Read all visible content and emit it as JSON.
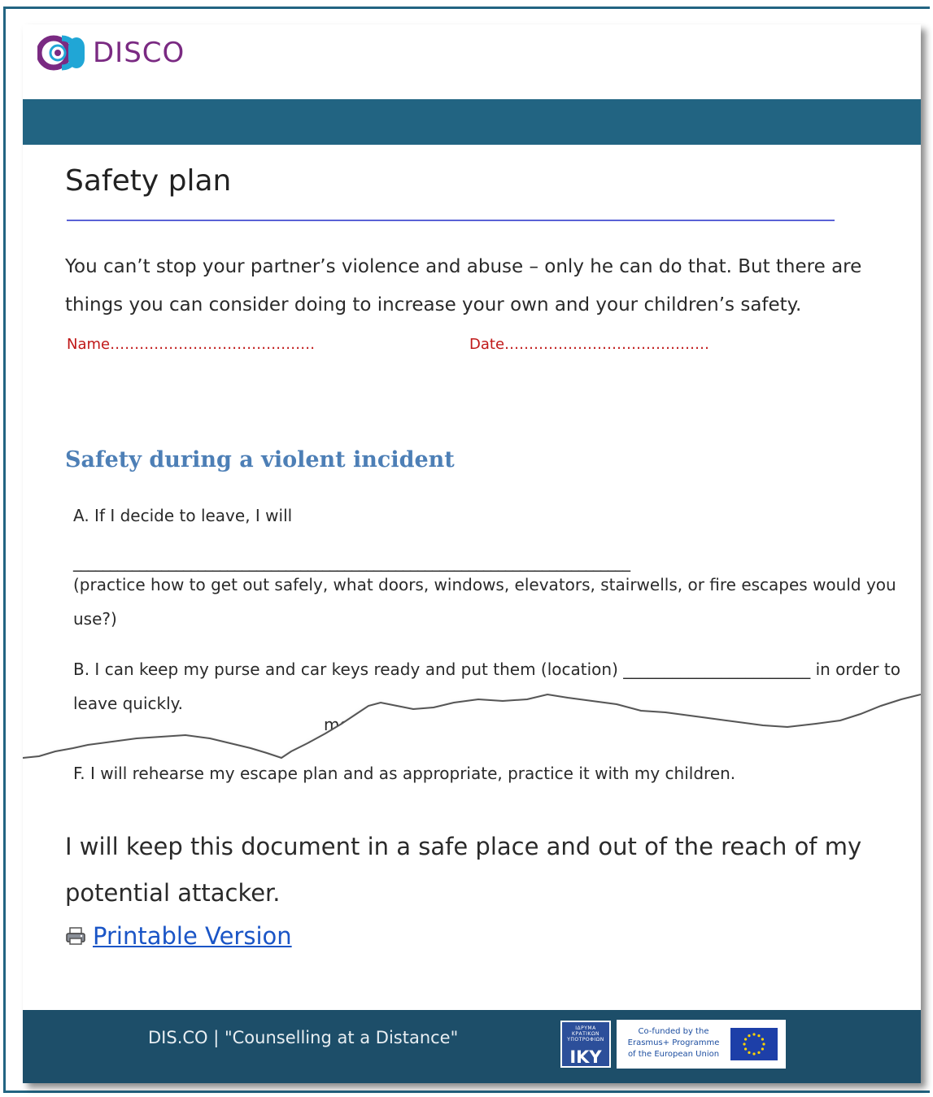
{
  "brand": {
    "logo_text": "DISCO",
    "logo_colors": [
      "#7a2a82",
      "#20a6d6"
    ]
  },
  "page": {
    "title": "Safety plan"
  },
  "intro": {
    "text": "You can’t stop your partner’s violence and abuse – only he can do that. But there are things you can consider doing to increase your own and your children’s safety."
  },
  "fields": {
    "name_label": "Name……………………………………",
    "date_label": "Date……………………………………"
  },
  "section": {
    "heading": "Safety during a violent incident",
    "items": {
      "a_prompt": "A. If I decide to leave, I will",
      "a_blank": "____________________________________________________________________________",
      "a_note": "(practice how to get out safely, what doors, windows, elevators, stairwells, or fire escapes would you use?)",
      "b_text": "B. I can keep my purse and car keys ready and put them (location) _______________________ in order to leave quickly.",
      "e_fragment": "money in a suitcase with ______________________________________.",
      "f_text": "F. I will rehearse my escape plan and as appropriate, practice it with my children."
    }
  },
  "closing": {
    "text": "I will keep this document in a safe place and out of the reach of my potential attacker."
  },
  "print": {
    "label": "Printable Version"
  },
  "footer": {
    "text": "DIS.CO | \"Counselling at a Distance\"",
    "iky_label": "IKY",
    "iky_small": "ΙΔΡΥΜΑ ΚΡΑΤΙΚΩΝ ΥΠΟΤΡΟΦΙΩΝ",
    "erasmus_text": "Co-funded by the Erasmus+ Programme of the European Union"
  },
  "colors": {
    "accent": "#226482",
    "footer": "#1d4e69",
    "heading": "#4d7fb6",
    "field_label": "#c01818",
    "link": "#1a55c6"
  }
}
